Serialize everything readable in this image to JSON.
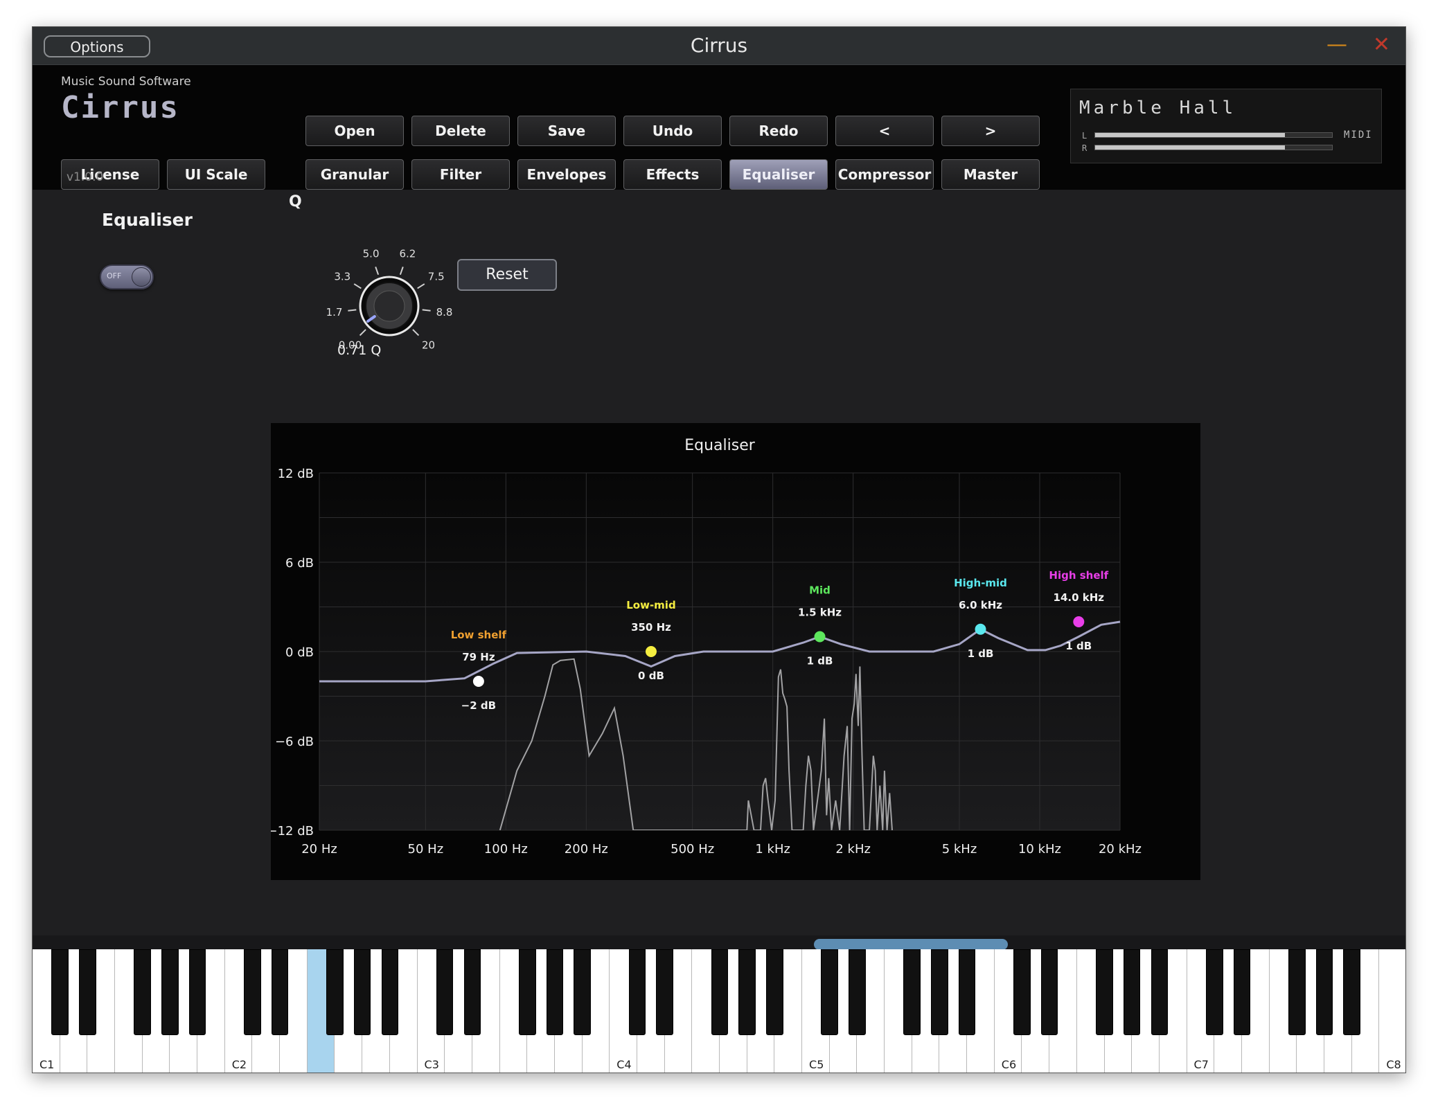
{
  "window": {
    "title": "Cirrus",
    "options_label": "Options",
    "minimize_glyph": "—",
    "close_glyph": "✕"
  },
  "brand": {
    "subtitle": "Music Sound Software",
    "logo": "Cirrus",
    "version": "v1.0.0"
  },
  "left_buttons": [
    "License",
    "UI Scale"
  ],
  "toolbar_row1": [
    "Open",
    "Delete",
    "Save",
    "Undo",
    "Redo",
    "<",
    ">"
  ],
  "toolbar_row2": [
    "Granular",
    "Filter",
    "Envelopes",
    "Effects",
    "Equaliser",
    "Compressor",
    "Master"
  ],
  "active_tab": "Equaliser",
  "preset": {
    "name": "Marble Hall",
    "meter_l_label": "L",
    "meter_r_label": "R",
    "meter_l_level": 0.8,
    "meter_r_level": 0.8,
    "midi_label": "MIDI"
  },
  "equaliser_panel": {
    "heading": "Equaliser",
    "toggle_state": "OFF"
  },
  "q_knob": {
    "label": "Q",
    "scale": [
      "0.00",
      "1.7",
      "3.3",
      "5.0",
      "6.2",
      "7.5",
      "8.8",
      "20"
    ],
    "value": 0.71,
    "value_text": "0.71 Q"
  },
  "reset_label": "Reset",
  "chart_data": {
    "type": "line",
    "title": "Equaliser",
    "x_scale": "log",
    "xlim": [
      20,
      20000
    ],
    "ylim": [
      -12,
      12
    ],
    "x_ticks": [
      {
        "value": 20,
        "label": "20 Hz"
      },
      {
        "value": 50,
        "label": "50 Hz"
      },
      {
        "value": 100,
        "label": "100 Hz"
      },
      {
        "value": 200,
        "label": "200 Hz"
      },
      {
        "value": 500,
        "label": "500 Hz"
      },
      {
        "value": 1000,
        "label": "1 kHz"
      },
      {
        "value": 2000,
        "label": "2 kHz"
      },
      {
        "value": 5000,
        "label": "5 kHz"
      },
      {
        "value": 10000,
        "label": "10 kHz"
      },
      {
        "value": 20000,
        "label": "20 kHz"
      }
    ],
    "y_ticks": [
      {
        "value": 12,
        "label": "12 dB"
      },
      {
        "value": 6,
        "label": "6 dB"
      },
      {
        "value": 0,
        "label": "0 dB"
      },
      {
        "value": -6,
        "label": "−6 dB"
      },
      {
        "value": -12,
        "label": "−12 dB"
      }
    ],
    "grid": true,
    "bands": [
      {
        "name": "Low shelf",
        "freq": 79,
        "gain": -2,
        "freq_label": "79 Hz",
        "gain_label": "−2 dB",
        "color": "#ffffff",
        "name_color": "#f0a030"
      },
      {
        "name": "Low-mid",
        "freq": 350,
        "gain": 0,
        "freq_label": "350 Hz",
        "gain_label": "0 dB",
        "color": "#f5ee40",
        "name_color": "#f5ee40"
      },
      {
        "name": "Mid",
        "freq": 1500,
        "gain": 1,
        "freq_label": "1.5 kHz",
        "gain_label": "1 dB",
        "color": "#5de65d",
        "name_color": "#5de65d"
      },
      {
        "name": "High-mid",
        "freq": 6000,
        "gain": 1.5,
        "freq_label": "6.0 kHz",
        "gain_label": "1 dB",
        "color": "#5ae8ee",
        "name_color": "#5ae8ee"
      },
      {
        "name": "High shelf",
        "freq": 14000,
        "gain": 2,
        "freq_label": "14.0 kHz",
        "gain_label": "1 dB",
        "color": "#e83ee8",
        "name_color": "#e83ee8"
      }
    ],
    "response_curve": [
      [
        20,
        -2
      ],
      [
        50,
        -2
      ],
      [
        70,
        -1.8
      ],
      [
        90,
        -0.8
      ],
      [
        110,
        -0.1
      ],
      [
        200,
        0
      ],
      [
        280,
        -0.3
      ],
      [
        350,
        -1
      ],
      [
        430,
        -0.3
      ],
      [
        550,
        0
      ],
      [
        1000,
        0
      ],
      [
        1300,
        0.6
      ],
      [
        1500,
        1
      ],
      [
        1800,
        0.5
      ],
      [
        2300,
        0
      ],
      [
        4000,
        0
      ],
      [
        5000,
        0.5
      ],
      [
        6000,
        1.5
      ],
      [
        7000,
        0.9
      ],
      [
        9000,
        0.1
      ],
      [
        10500,
        0.1
      ],
      [
        12000,
        0.4
      ],
      [
        14000,
        1
      ],
      [
        17000,
        1.8
      ],
      [
        20000,
        2
      ]
    ],
    "spectrum": [
      [
        95,
        -12
      ],
      [
        110,
        -8
      ],
      [
        125,
        -6
      ],
      [
        140,
        -3
      ],
      [
        150,
        -0.9
      ],
      [
        160,
        -0.6
      ],
      [
        180,
        -0.5
      ],
      [
        190,
        -2.5
      ],
      [
        205,
        -7
      ],
      [
        230,
        -5.5
      ],
      [
        255,
        -3.8
      ],
      [
        275,
        -7
      ],
      [
        300,
        -12
      ],
      [
        800,
        -12
      ],
      [
        810,
        -10
      ],
      [
        830,
        -11
      ],
      [
        850,
        -12
      ],
      [
        900,
        -12
      ],
      [
        920,
        -9
      ],
      [
        940,
        -8.5
      ],
      [
        960,
        -10
      ],
      [
        990,
        -12
      ],
      [
        1020,
        -10
      ],
      [
        1050,
        -1.7
      ],
      [
        1070,
        -1.2
      ],
      [
        1090,
        -2.8
      ],
      [
        1110,
        -3.2
      ],
      [
        1130,
        -3.7
      ],
      [
        1150,
        -8
      ],
      [
        1180,
        -12
      ],
      [
        1300,
        -12
      ],
      [
        1330,
        -9
      ],
      [
        1360,
        -7
      ],
      [
        1390,
        -8
      ],
      [
        1420,
        -12
      ],
      [
        1470,
        -10
      ],
      [
        1520,
        -8
      ],
      [
        1560,
        -4.5
      ],
      [
        1590,
        -11
      ],
      [
        1620,
        -8.5
      ],
      [
        1660,
        -12
      ],
      [
        1720,
        -10
      ],
      [
        1780,
        -12
      ],
      [
        1850,
        -7
      ],
      [
        1900,
        -5
      ],
      [
        1940,
        -12
      ],
      [
        1980,
        -4.5
      ],
      [
        2020,
        -3.5
      ],
      [
        2050,
        -1.5
      ],
      [
        2090,
        -5
      ],
      [
        2120,
        -1
      ],
      [
        2160,
        -7
      ],
      [
        2200,
        -12
      ],
      [
        2300,
        -12
      ],
      [
        2380,
        -7
      ],
      [
        2420,
        -8
      ],
      [
        2460,
        -12
      ],
      [
        2520,
        -9
      ],
      [
        2580,
        -12
      ],
      [
        2620,
        -8
      ],
      [
        2680,
        -12
      ],
      [
        2740,
        -9.5
      ],
      [
        2800,
        -12
      ]
    ]
  },
  "keyboard": {
    "octave_labels": [
      "C1",
      "C2",
      "C3",
      "C4",
      "C5",
      "C6",
      "C7",
      "C8"
    ],
    "pressed_key": "F2"
  }
}
